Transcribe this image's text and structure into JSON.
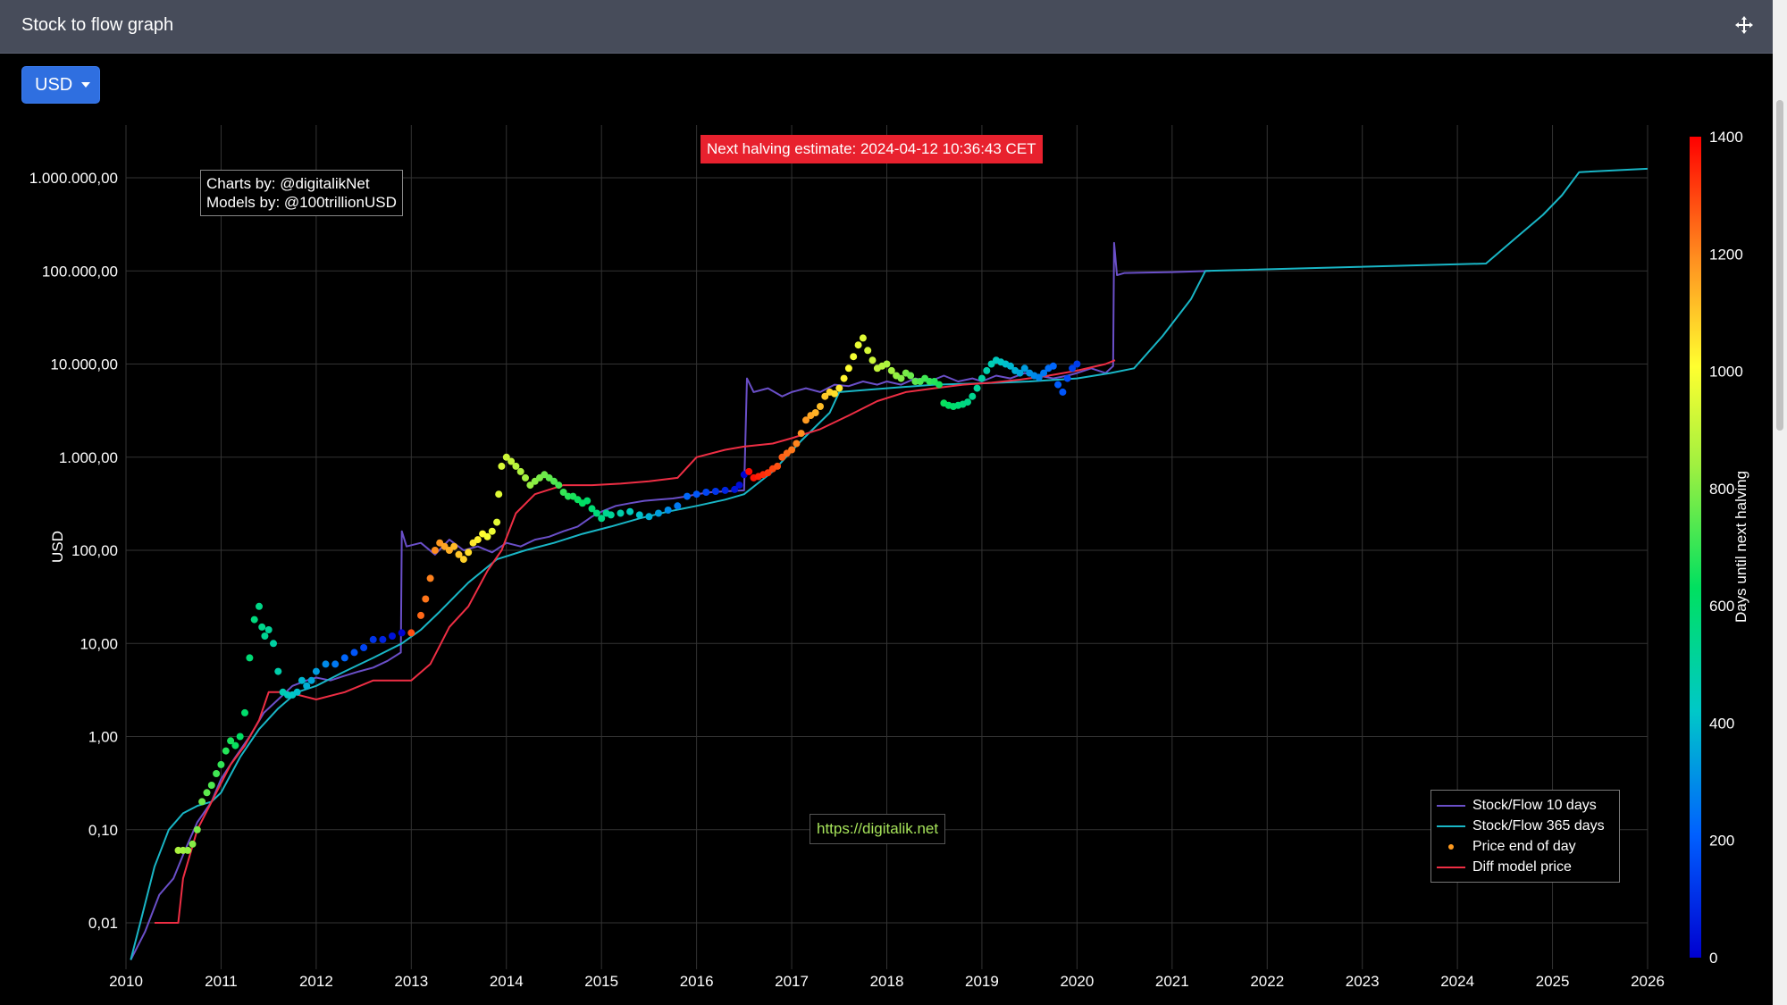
{
  "window": {
    "title": "Stock to flow graph",
    "currency_button": "USD"
  },
  "annotations": {
    "halving": "Next halving estimate: 2024-04-12 10:36:43 CET",
    "credits_line1": "Charts by: @digitalikNet",
    "credits_line2": "Models by: @100trillionUSD",
    "watermark": "https://digitalik.net"
  },
  "colors": {
    "sf10": "#6a4fc8",
    "sf365": "#19b6c6",
    "price": "#ff9a1f",
    "diff": "#ee2e44",
    "halving_banner": "#e8212e"
  },
  "legend": [
    {
      "label": "Stock/Flow 10 days",
      "kind": "line",
      "color": "#6a4fc8"
    },
    {
      "label": "Stock/Flow 365 days",
      "kind": "line",
      "color": "#19b6c6"
    },
    {
      "label": "Price end of day",
      "kind": "dot",
      "color": "#ff9a1f"
    },
    {
      "label": "Diff model price",
      "kind": "line",
      "color": "#ee2e44"
    }
  ],
  "chart_data": {
    "type": "line",
    "ylabel": "USD",
    "y_scale": "log",
    "ylim": [
      0.0025,
      2000000
    ],
    "xlim": [
      2010,
      2026
    ],
    "x_ticks": [
      "2010",
      "2011",
      "2012",
      "2013",
      "2014",
      "2015",
      "2016",
      "2017",
      "2018",
      "2019",
      "2020",
      "2021",
      "2022",
      "2023",
      "2024",
      "2025",
      "2026"
    ],
    "y_ticks": [
      {
        "value": 0.01,
        "label": "0,01"
      },
      {
        "value": 0.1,
        "label": "0,10"
      },
      {
        "value": 1,
        "label": "1,00"
      },
      {
        "value": 10,
        "label": "10,00"
      },
      {
        "value": 100,
        "label": "100,00"
      },
      {
        "value": 1000,
        "label": "1.000,00"
      },
      {
        "value": 10000,
        "label": "10.000,00"
      },
      {
        "value": 100000,
        "label": "100.000,00"
      },
      {
        "value": 1000000,
        "label": "1.000.000,00"
      }
    ],
    "grid": true,
    "legend_position": "bottom-right",
    "colorbar": {
      "title": "Days until next halving",
      "range": [
        0,
        1400
      ],
      "ticks": [
        0,
        200,
        400,
        600,
        800,
        1000,
        1200,
        1400
      ],
      "colorscale": "jet"
    },
    "series": [
      {
        "name": "Stock/Flow 10 days",
        "x": [
          2010.05,
          2010.2,
          2010.35,
          2010.5,
          2010.62,
          2010.75,
          2010.9,
          2011.0,
          2011.15,
          2011.3,
          2011.45,
          2011.6,
          2011.75,
          2011.9,
          2012.0,
          2012.15,
          2012.3,
          2012.45,
          2012.6,
          2012.75,
          2012.89,
          2012.9,
          2012.95,
          2013.1,
          2013.25,
          2013.4,
          2013.55,
          2013.7,
          2013.85,
          2014.0,
          2014.15,
          2014.3,
          2014.45,
          2014.6,
          2014.75,
          2014.9,
          2015.0,
          2015.15,
          2015.3,
          2015.45,
          2015.6,
          2015.75,
          2015.9,
          2016.0,
          2016.15,
          2016.3,
          2016.5,
          2016.53,
          2016.6,
          2016.75,
          2016.9,
          2017.0,
          2017.15,
          2017.3,
          2017.45,
          2017.6,
          2017.75,
          2017.9,
          2018.0,
          2018.15,
          2018.3,
          2018.45,
          2018.6,
          2018.75,
          2018.9,
          2019.0,
          2019.15,
          2019.3,
          2019.45,
          2019.6,
          2019.75,
          2019.9,
          2020.0,
          2020.15,
          2020.3,
          2020.38,
          2020.39,
          2020.42,
          2020.5,
          2021.0,
          2021.4
        ],
        "y": [
          0.004,
          0.008,
          0.02,
          0.03,
          0.06,
          0.12,
          0.2,
          0.35,
          0.6,
          1.0,
          1.8,
          2.5,
          3.5,
          4.0,
          4.3,
          4.0,
          4.5,
          5.0,
          5.5,
          6.5,
          8.0,
          160,
          110,
          120,
          90,
          130,
          100,
          110,
          95,
          120,
          110,
          130,
          140,
          160,
          180,
          230,
          260,
          300,
          320,
          340,
          350,
          360,
          380,
          400,
          420,
          430,
          440,
          7000,
          5000,
          5500,
          4500,
          5000,
          5500,
          5000,
          6000,
          5800,
          6500,
          6000,
          6500,
          6000,
          7000,
          6500,
          7500,
          6500,
          7000,
          6500,
          7500,
          7000,
          8000,
          7500,
          7000,
          7500,
          8000,
          9000,
          8000,
          9500,
          200000,
          90000,
          95000,
          97000,
          100000
        ]
      },
      {
        "name": "Stock/Flow 365 days",
        "x": [
          2010.05,
          2010.15,
          2010.3,
          2010.45,
          2010.6,
          2010.75,
          2010.9,
          2011.0,
          2011.2,
          2011.4,
          2011.6,
          2011.8,
          2012.0,
          2012.3,
          2012.6,
          2012.9,
          2013.1,
          2013.3,
          2013.6,
          2013.9,
          2014.2,
          2014.5,
          2014.8,
          2015.1,
          2015.4,
          2015.7,
          2016.0,
          2016.3,
          2016.5,
          2016.8,
          2017.1,
          2017.4,
          2017.5,
          2018.0,
          2018.5,
          2019.0,
          2019.5,
          2020.0,
          2020.35,
          2020.6,
          2020.9,
          2021.2,
          2021.35,
          2024.3,
          2024.6,
          2024.9,
          2025.1,
          2025.28,
          2026.0
        ],
        "y": [
          0.004,
          0.01,
          0.04,
          0.1,
          0.15,
          0.18,
          0.2,
          0.25,
          0.6,
          1.2,
          2.0,
          3.0,
          3.5,
          5.0,
          7.0,
          10,
          14,
          22,
          45,
          80,
          100,
          120,
          150,
          180,
          220,
          260,
          300,
          350,
          400,
          700,
          1500,
          3000,
          5000,
          5500,
          6000,
          6200,
          6500,
          7000,
          8000,
          9000,
          20000,
          50000,
          100000,
          120000,
          220000,
          400000,
          650000,
          1150000,
          1250000
        ]
      },
      {
        "name": "Diff model price",
        "x": [
          2010.3,
          2010.35,
          2010.55,
          2010.6,
          2010.75,
          2010.95,
          2011.1,
          2011.25,
          2011.4,
          2011.5,
          2011.7,
          2012.0,
          2012.3,
          2012.6,
          2012.8,
          2013.0,
          2013.2,
          2013.4,
          2013.6,
          2013.8,
          2013.95,
          2014.1,
          2014.3,
          2014.6,
          2014.9,
          2015.2,
          2015.5,
          2015.8,
          2016.0,
          2016.3,
          2016.5,
          2016.8,
          2017.0,
          2017.3,
          2017.6,
          2017.9,
          2018.2,
          2018.5,
          2018.8,
          2019.1,
          2019.4,
          2019.7,
          2020.0,
          2020.3,
          2020.4
        ],
        "y": [
          0.01,
          0.01,
          0.01,
          0.03,
          0.1,
          0.25,
          0.5,
          0.8,
          1.5,
          3.0,
          3.0,
          2.5,
          3.0,
          4.0,
          4.0,
          4.0,
          6.0,
          15,
          25,
          60,
          100,
          250,
          400,
          500,
          500,
          520,
          550,
          600,
          1000,
          1200,
          1300,
          1400,
          1600,
          2000,
          2800,
          4000,
          5000,
          5500,
          6000,
          6300,
          6800,
          7500,
          8500,
          10000,
          11000
        ]
      }
    ],
    "price_points": {
      "name": "Price end of day",
      "x": [
        2010.55,
        2010.6,
        2010.65,
        2010.7,
        2010.75,
        2010.8,
        2010.85,
        2010.9,
        2010.95,
        2011.0,
        2011.05,
        2011.1,
        2011.15,
        2011.2,
        2011.25,
        2011.3,
        2011.35,
        2011.4,
        2011.43,
        2011.46,
        2011.5,
        2011.55,
        2011.6,
        2011.65,
        2011.7,
        2011.75,
        2011.8,
        2011.85,
        2011.9,
        2011.95,
        2012.0,
        2012.1,
        2012.2,
        2012.3,
        2012.4,
        2012.5,
        2012.6,
        2012.7,
        2012.8,
        2012.9,
        2013.0,
        2013.1,
        2013.15,
        2013.2,
        2013.25,
        2013.3,
        2013.35,
        2013.4,
        2013.45,
        2013.5,
        2013.55,
        2013.6,
        2013.65,
        2013.7,
        2013.75,
        2013.8,
        2013.85,
        2013.9,
        2013.92,
        2013.95,
        2014.0,
        2014.05,
        2014.1,
        2014.15,
        2014.2,
        2014.25,
        2014.3,
        2014.35,
        2014.4,
        2014.45,
        2014.5,
        2014.55,
        2014.6,
        2014.65,
        2014.7,
        2014.75,
        2014.8,
        2014.85,
        2014.9,
        2014.95,
        2015.0,
        2015.05,
        2015.1,
        2015.2,
        2015.3,
        2015.4,
        2015.5,
        2015.6,
        2015.7,
        2015.8,
        2015.9,
        2016.0,
        2016.1,
        2016.2,
        2016.3,
        2016.4,
        2016.45,
        2016.5,
        2016.55,
        2016.6,
        2016.65,
        2016.7,
        2016.75,
        2016.8,
        2016.85,
        2016.9,
        2016.95,
        2017.0,
        2017.05,
        2017.1,
        2017.15,
        2017.2,
        2017.25,
        2017.3,
        2017.35,
        2017.4,
        2017.45,
        2017.5,
        2017.55,
        2017.6,
        2017.65,
        2017.7,
        2017.75,
        2017.8,
        2017.85,
        2017.9,
        2017.95,
        2018.0,
        2018.05,
        2018.1,
        2018.15,
        2018.2,
        2018.25,
        2018.3,
        2018.35,
        2018.4,
        2018.45,
        2018.5,
        2018.55,
        2018.6,
        2018.65,
        2018.7,
        2018.75,
        2018.8,
        2018.85,
        2018.9,
        2018.95,
        2019.0,
        2019.05,
        2019.1,
        2019.15,
        2019.2,
        2019.25,
        2019.3,
        2019.35,
        2019.4,
        2019.45,
        2019.5,
        2019.55,
        2019.6,
        2019.65,
        2019.7,
        2019.75,
        2019.8,
        2019.85,
        2019.9,
        2019.95,
        2020.0,
        2020.05,
        2020.1,
        2020.15,
        2020.2,
        2020.25,
        2020.3,
        2020.35,
        2020.38
      ],
      "y": [
        0.06,
        0.06,
        0.06,
        0.07,
        0.1,
        0.2,
        0.25,
        0.3,
        0.4,
        0.5,
        0.7,
        0.9,
        0.8,
        1.0,
        1.8,
        7,
        18,
        25,
        15,
        12,
        14,
        10,
        5,
        3,
        2.8,
        2.8,
        3,
        4,
        3.5,
        4,
        5,
        6,
        6,
        7,
        8,
        9,
        11,
        11,
        12,
        13,
        13,
        20,
        30,
        50,
        100,
        120,
        110,
        100,
        110,
        90,
        80,
        95,
        120,
        130,
        150,
        140,
        160,
        200,
        400,
        800,
        1000,
        900,
        800,
        700,
        600,
        500,
        550,
        600,
        650,
        600,
        550,
        500,
        420,
        380,
        380,
        350,
        320,
        340,
        280,
        250,
        220,
        250,
        240,
        250,
        260,
        240,
        230,
        250,
        270,
        300,
        380,
        400,
        420,
        430,
        440,
        450,
        500,
        650,
        700,
        600,
        620,
        650,
        680,
        750,
        800,
        1000,
        1100,
        1200,
        1400,
        1800,
        2500,
        2800,
        3000,
        3500,
        4500,
        5000,
        4800,
        5500,
        7000,
        9000,
        12000,
        16000,
        19000,
        14000,
        11000,
        9000,
        9500,
        10000,
        8500,
        7500,
        7000,
        8000,
        7500,
        6500,
        6500,
        7000,
        6500,
        6500,
        6000,
        3800,
        3600,
        3500,
        3600,
        3700,
        3900,
        4500,
        5500,
        7000,
        8500,
        10000,
        11000,
        10500,
        10000,
        9500,
        8500,
        8000,
        9000,
        8000,
        7500,
        7200,
        8000,
        9000,
        9500,
        6000,
        5000,
        7000,
        9000,
        10000
      ]
    }
  }
}
